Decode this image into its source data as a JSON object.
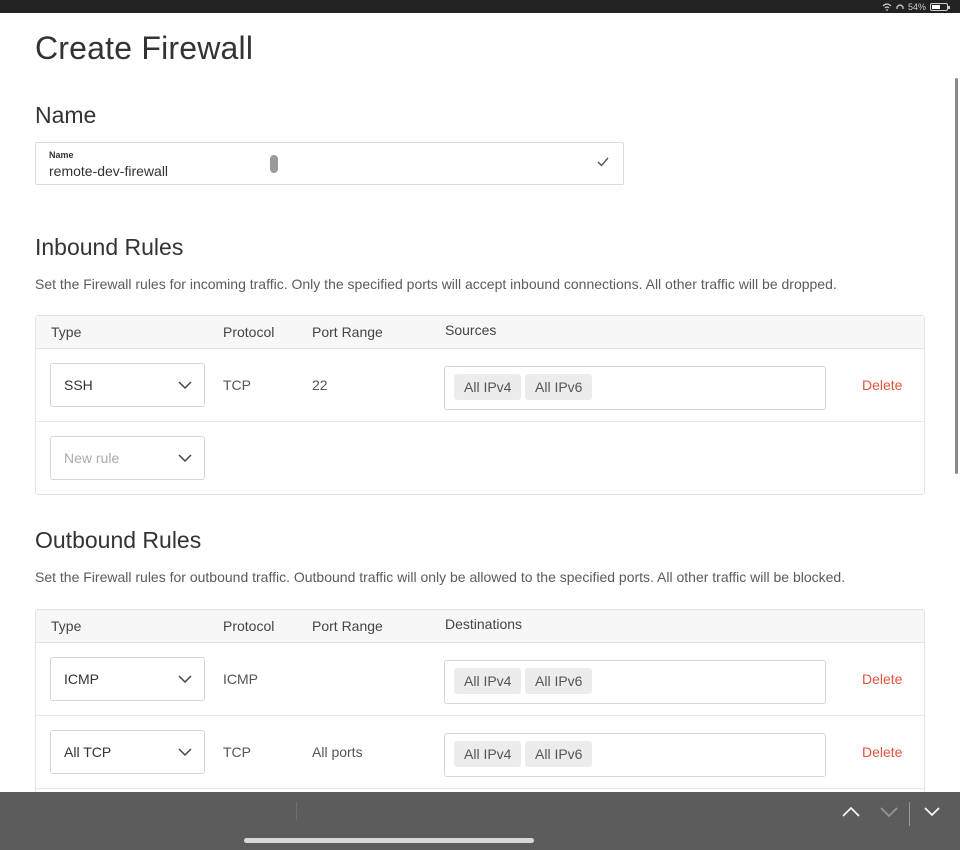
{
  "status_bar": {
    "battery": "54%"
  },
  "page": {
    "title": "Create Firewall"
  },
  "name_section": {
    "heading": "Name",
    "field_label": "Name",
    "field_value": "remote-dev-firewall"
  },
  "inbound": {
    "heading": "Inbound Rules",
    "description": "Set the Firewall rules for incoming traffic. Only the specified ports will accept inbound connections. All other traffic will be dropped.",
    "columns": {
      "type": "Type",
      "protocol": "Protocol",
      "port_range": "Port Range",
      "sources": "Sources"
    },
    "rows": [
      {
        "type": "SSH",
        "protocol": "TCP",
        "port_range": "22",
        "tags": [
          "All IPv4",
          "All IPv6"
        ],
        "action": "Delete"
      }
    ],
    "new_rule_placeholder": "New rule"
  },
  "outbound": {
    "heading": "Outbound Rules",
    "description": "Set the Firewall rules for outbound traffic. Outbound traffic will only be allowed to the specified ports. All other traffic will be blocked.",
    "columns": {
      "type": "Type",
      "protocol": "Protocol",
      "port_range": "Port Range",
      "destinations": "Destinations"
    },
    "rows": [
      {
        "type": "ICMP",
        "protocol": "ICMP",
        "port_range": "",
        "tags": [
          "All IPv4",
          "All IPv6"
        ],
        "action": "Delete"
      },
      {
        "type": "All TCP",
        "protocol": "TCP",
        "port_range": "All ports",
        "tags": [
          "All IPv4",
          "All IPv6"
        ],
        "action": "Delete"
      }
    ]
  },
  "colors": {
    "delete": "#e0533c",
    "text": "#333333",
    "tag_bg": "#ececec",
    "header_bg": "#f7f7f7"
  },
  "icons": [
    "wifi-icon",
    "headphones-icon",
    "battery-icon",
    "check-icon",
    "chevron-down-icon",
    "chevron-up-icon",
    "keyboard-dismiss-icon"
  ]
}
